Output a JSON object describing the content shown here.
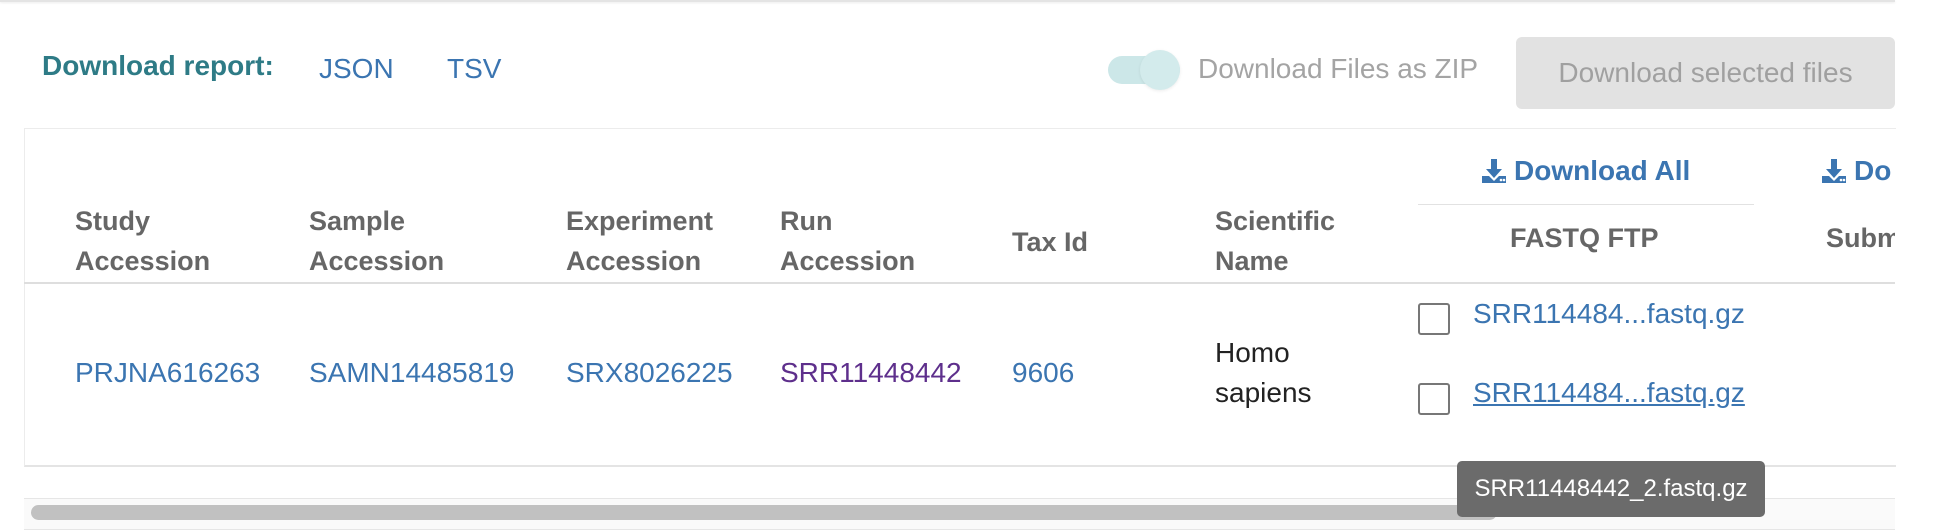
{
  "report": {
    "label": "Download report:",
    "formats": [
      "JSON",
      "TSV"
    ]
  },
  "zip_toggle": {
    "label": "Download Files as ZIP",
    "on": true
  },
  "download_selected_label": "Download selected files",
  "download_all_label": "Download All",
  "download_all_next_label": "Do",
  "columns": {
    "study": [
      "Study",
      "Accession"
    ],
    "sample": [
      "Sample",
      "Accession"
    ],
    "experiment": [
      "Experiment",
      "Accession"
    ],
    "run": [
      "Run",
      "Accession"
    ],
    "tax": "Tax Id",
    "scientific": [
      "Scientific",
      "Name"
    ],
    "fastq": "FASTQ FTP",
    "submitted": "Subm"
  },
  "row": {
    "study": "PRJNA616263",
    "sample": "SAMN14485819",
    "experiment": "SRX8026225",
    "run": "SRR11448442",
    "tax": "9606",
    "scientific": [
      "Homo",
      "sapiens"
    ],
    "files": [
      {
        "label": "SRR114484...fastq.gz",
        "checked": false
      },
      {
        "label": "SRR114484...fastq.gz",
        "checked": false
      }
    ]
  },
  "tooltip": "SRR11448442_2.fastq.gz",
  "colors": {
    "accent": "#2e7b86",
    "link": "#3b75b1",
    "visited": "#5e2f8c"
  },
  "icons": {
    "download": "download-icon"
  }
}
